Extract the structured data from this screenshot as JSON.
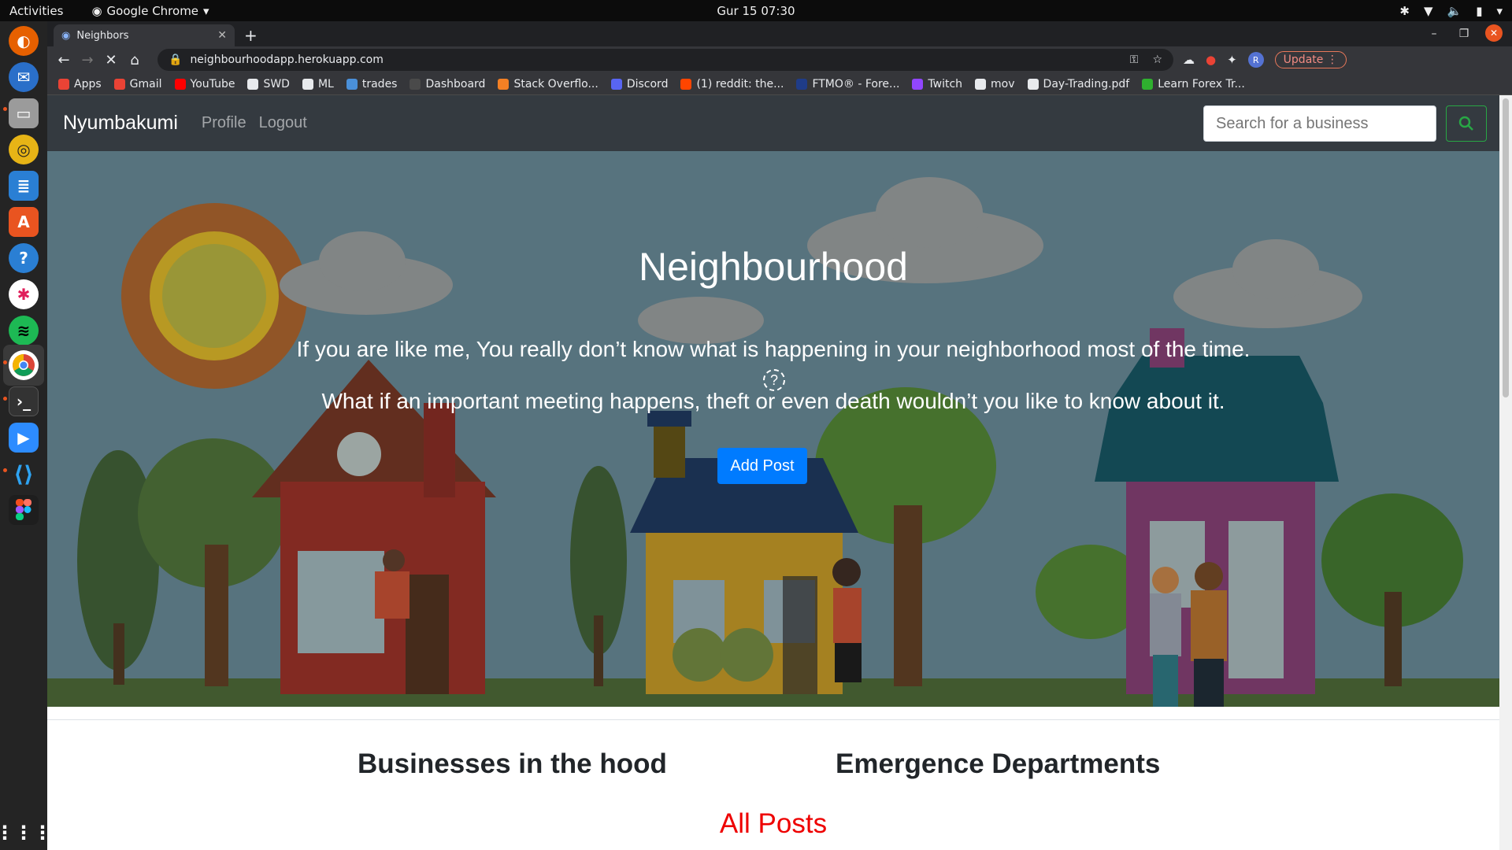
{
  "system": {
    "activities": "Activities",
    "app_name": "Google Chrome",
    "clock": "Gur 15  07:30"
  },
  "browser": {
    "tab_title": "Neighbors",
    "url": "neighbourhoodapp.herokuapp.com",
    "update_label": "Update",
    "profile_initial": "R",
    "bookmarks": [
      {
        "label": "Apps",
        "color": "#ea4335"
      },
      {
        "label": "Gmail",
        "color": "#ea4335"
      },
      {
        "label": "YouTube",
        "color": "#ff0000"
      },
      {
        "label": "SWD",
        "color": "#e8eaed"
      },
      {
        "label": "ML",
        "color": "#e8eaed"
      },
      {
        "label": "trades",
        "color": "#4a90d9"
      },
      {
        "label": "Dashboard",
        "color": "#4a4a4a"
      },
      {
        "label": "Stack Overflo...",
        "color": "#f48024"
      },
      {
        "label": "Discord",
        "color": "#5865f2"
      },
      {
        "label": "(1) reddit: the...",
        "color": "#ff4500"
      },
      {
        "label": "FTMO® - Fore...",
        "color": "#1f3c88"
      },
      {
        "label": "Twitch",
        "color": "#9146ff"
      },
      {
        "label": "mov",
        "color": "#e8eaed"
      },
      {
        "label": "Day-Trading.pdf",
        "color": "#e8eaed"
      },
      {
        "label": "Learn Forex Tr...",
        "color": "#2fb02f"
      }
    ]
  },
  "site": {
    "brand": "Nyumbakumi",
    "nav_profile": "Profile",
    "nav_logout": "Logout",
    "search_placeholder": "Search for a business",
    "hero": {
      "title": "Neighbourhood",
      "line1": "If you are like me, You really don’t know what is happening in your neighborhood most of the time.",
      "line2": "What if an important meeting happens, theft or even death wouldn’t you like to know about it.",
      "help_glyph": "?",
      "add_post": "Add Post"
    },
    "businesses_heading": "Businesses in the hood",
    "emergency_heading": "Emergence Departments",
    "all_posts": "All Posts"
  }
}
